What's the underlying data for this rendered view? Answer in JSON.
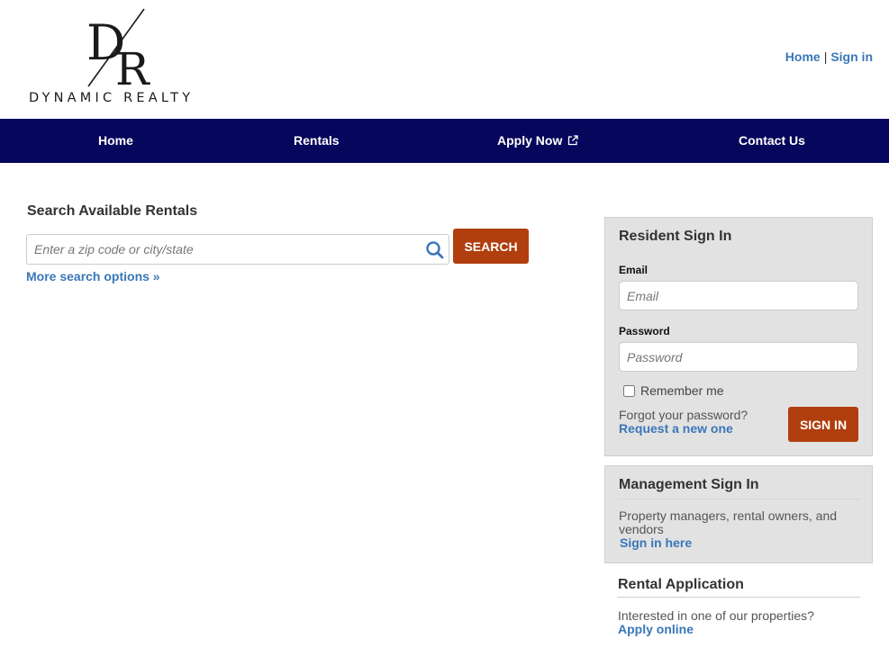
{
  "logo": {
    "monogram": "D/R",
    "name": "DYNAMIC REALTY"
  },
  "toplinks": {
    "home": "Home",
    "separator": "|",
    "signin": "Sign in"
  },
  "nav": {
    "items": [
      "Home",
      "Rentals",
      "Apply Now",
      "Contact Us"
    ],
    "background": "#06065c"
  },
  "search": {
    "title": "Search Available Rentals",
    "placeholder": "Enter a zip code or city/state",
    "button": "SEARCH",
    "more": "More search options »"
  },
  "resident": {
    "title": "Resident Sign In",
    "email_label": "Email",
    "email_placeholder": "Email",
    "password_label": "Password",
    "password_placeholder": "Password",
    "remember": "Remember me",
    "forgot": "Forgot your password?",
    "request": "Request a new one",
    "button": "SIGN IN"
  },
  "management": {
    "title": "Management Sign In",
    "text": "Property managers, rental owners, and vendors",
    "link": "Sign in here"
  },
  "rental_app": {
    "title": "Rental Application",
    "text": "Interested in one of our properties?",
    "link": "Apply online"
  },
  "colors": {
    "accent_button": "#b13e0e",
    "link": "#3a77b8",
    "panel": "#e2e2e2"
  },
  "icons": {
    "search": "search-icon",
    "external": "external-link-icon"
  }
}
